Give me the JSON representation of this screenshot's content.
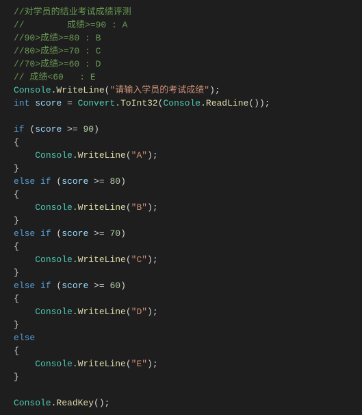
{
  "comments": {
    "c1": "//对学员的结业考试成绩评测",
    "c2": "//        成绩>=90 : A",
    "c3": "//90>成绩>=80 : B",
    "c4": "//80>成绩>=70 : C",
    "c5": "//70>成绩>=60 : D",
    "c6": "// 成绩<60   : E"
  },
  "tok": {
    "Console": "Console",
    "WriteLine": "WriteLine",
    "ReadLine": "ReadLine",
    "ReadKey": "ReadKey",
    "Convert": "Convert",
    "ToInt32": "ToInt32",
    "int": "int",
    "score": "score",
    "if": "if",
    "else": "else",
    "else_if": "else if",
    "obrace": "{",
    "cbrace": "}",
    "oparen": "(",
    "cparen": ")",
    "semi": ";",
    "dot": ".",
    "eq": " = ",
    "gte": " >= "
  },
  "str": {
    "prompt": "\"请输入学员的考试成绩\"",
    "A": "\"A\"",
    "B": "\"B\"",
    "C": "\"C\"",
    "D": "\"D\"",
    "E": "\"E\""
  },
  "num": {
    "n90": "90",
    "n80": "80",
    "n70": "70",
    "n60": "60"
  }
}
